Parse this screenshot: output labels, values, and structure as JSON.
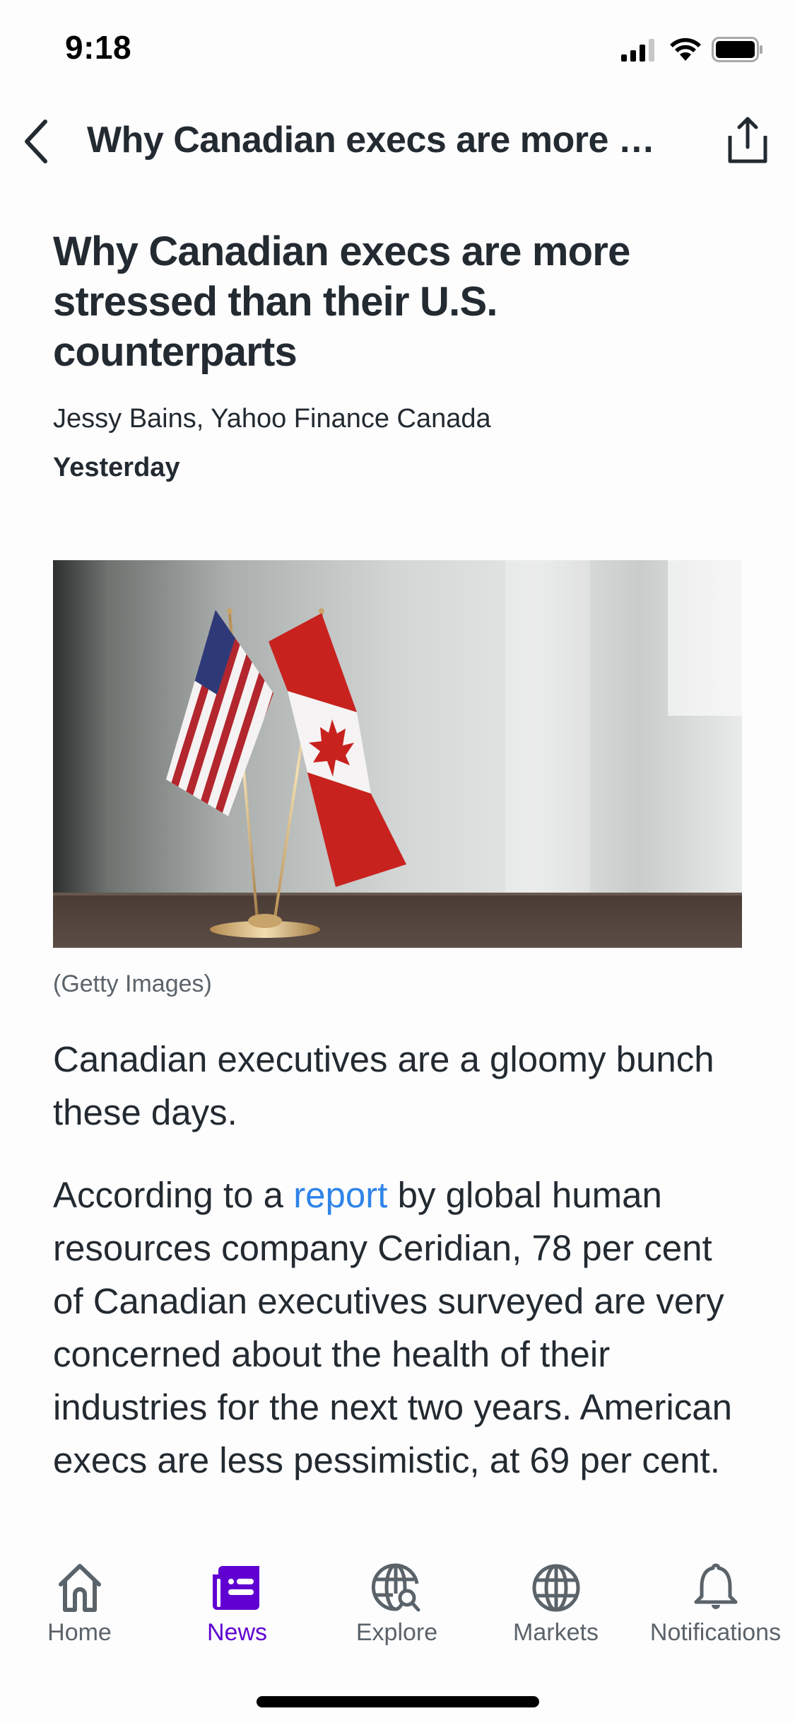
{
  "status_bar": {
    "time": "9:18",
    "icons": [
      "cellular-signal-icon",
      "wifi-icon",
      "battery-icon"
    ]
  },
  "nav": {
    "back_icon": "chevron-left-icon",
    "title": "Why Canadian execs are more s...",
    "share_icon": "share-icon"
  },
  "article": {
    "headline": "Why Canadian execs are more stressed than their U.S. counterparts",
    "byline": "Jessy Bains, Yahoo Finance Canada",
    "date": "Yesterday",
    "image_alt": "US and Canadian desk flags on a wooden table",
    "image_caption": "(Getty Images)",
    "paragraphs": [
      {
        "text": "Canadian executives are a gloomy bunch these days."
      },
      {
        "before": "According to a ",
        "link": "report",
        "after": " by global human resources company Ceridian, 78 per cent of Canadian executives surveyed are very concerned about the health of their industries for the next two years. American execs are less pessimistic, at 69 per cent."
      }
    ]
  },
  "tab_bar": {
    "active": "News",
    "accent_color": "#6001d2",
    "items": [
      {
        "label": "Home",
        "icon": "home-icon"
      },
      {
        "label": "News",
        "icon": "newspaper-icon"
      },
      {
        "label": "Explore",
        "icon": "globe-search-icon"
      },
      {
        "label": "Markets",
        "icon": "globe-icon"
      },
      {
        "label": "Notifications",
        "icon": "bell-icon"
      }
    ]
  },
  "colors": {
    "text": "#232a31",
    "secondary_text": "#5b636a",
    "link": "#2f84e8",
    "accent": "#6001d2"
  }
}
